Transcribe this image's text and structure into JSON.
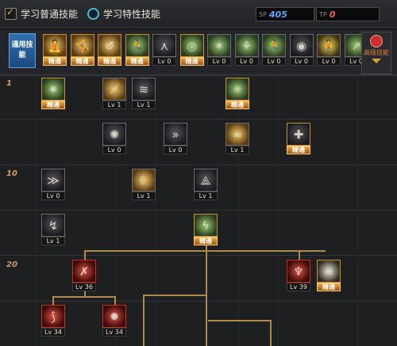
{
  "options": {
    "normal_skills": "学习普通技能",
    "special_skills": "学习特性技能"
  },
  "points": [
    {
      "label": "SP",
      "value": "405",
      "color": "#4aa8ff"
    },
    {
      "label": "TP",
      "value": "0",
      "color": "#ff5a3a"
    }
  ],
  "general_label": "通用技能",
  "advanced_label": "高级技能",
  "level_labels": [
    "1",
    "10",
    "20"
  ],
  "general_skills": [
    {
      "icon": "stance-icon",
      "glyph": "🧘",
      "badge": "精通",
      "mastered": true,
      "tone": "gold"
    },
    {
      "icon": "pose-icon",
      "glyph": "🤸",
      "badge": "精通",
      "mastered": true,
      "tone": "gold"
    },
    {
      "icon": "swing-icon",
      "glyph": "↺",
      "badge": "精通",
      "mastered": true,
      "tone": "gold"
    },
    {
      "icon": "runner-icon",
      "glyph": "🏃",
      "badge": "精通",
      "mastered": true,
      "tone": "green"
    },
    {
      "icon": "wings-icon",
      "glyph": "⋏",
      "badge": "Lv 0",
      "mastered": false,
      "tone": ""
    },
    {
      "icon": "target-icon",
      "glyph": "◎",
      "badge": "精通",
      "mastered": true,
      "tone": "green"
    },
    {
      "icon": "spin-icon",
      "glyph": "✶",
      "badge": "Lv 0",
      "mastered": false,
      "tone": "green"
    },
    {
      "icon": "leaf-icon",
      "glyph": "⚘",
      "badge": "Lv 0",
      "mastered": false,
      "tone": "green"
    },
    {
      "icon": "sprint-icon",
      "glyph": "🏃",
      "badge": "Lv 0",
      "mastered": false,
      "tone": "green"
    },
    {
      "icon": "shield-ring-icon",
      "glyph": "◉",
      "badge": "Lv 0",
      "mastered": false,
      "tone": ""
    },
    {
      "icon": "fighter-icon",
      "glyph": "🧍",
      "badge": "Lv 0",
      "mastered": false,
      "tone": "yellow"
    },
    {
      "icon": "dash-icon",
      "glyph": "↗",
      "badge": "Lv 0",
      "mastered": false,
      "tone": "green"
    }
  ],
  "tree_skills": [
    {
      "name": "whirl-kick-icon",
      "glyph": "✷",
      "badge": "精通",
      "mastered": true,
      "tone": "green"
    },
    {
      "name": "upper-slash-icon",
      "glyph": "⟋",
      "badge": "Lv 1",
      "mastered": false,
      "tone": "gold"
    },
    {
      "name": "triple-slash-icon",
      "glyph": "≋",
      "badge": "Lv 1",
      "mastered": false,
      "tone": ""
    },
    {
      "name": "back-step-icon",
      "glyph": "✳",
      "badge": "精通",
      "mastered": true,
      "tone": "green"
    },
    {
      "name": "burst-icon",
      "glyph": "✺",
      "badge": "Lv 0",
      "mastered": false,
      "tone": ""
    },
    {
      "name": "rush-icon",
      "glyph": "»",
      "badge": "Lv 0",
      "mastered": false,
      "tone": ""
    },
    {
      "name": "slash-wave-icon",
      "glyph": "≈",
      "badge": "Lv 1",
      "mastered": false,
      "tone": "gold"
    },
    {
      "name": "guard-icon",
      "glyph": "✚",
      "badge": "精通",
      "mastered": true,
      "tone": ""
    },
    {
      "name": "cross-cut-icon",
      "glyph": "≫",
      "badge": "Lv 0",
      "mastered": false,
      "tone": ""
    },
    {
      "name": "moon-slash-icon",
      "glyph": "☾",
      "badge": "Lv 1",
      "mastered": false,
      "tone": "gold"
    },
    {
      "name": "ghost-step-icon",
      "glyph": "⟁",
      "badge": "Lv 1",
      "mastered": false,
      "tone": ""
    },
    {
      "name": "wind-cut-icon",
      "glyph": "↯",
      "badge": "Lv 1",
      "mastered": false,
      "tone": ""
    },
    {
      "name": "lightning-icon",
      "glyph": "ϟ",
      "badge": "精通",
      "mastered": true,
      "tone": "green"
    },
    {
      "name": "blood-slash-icon",
      "glyph": "✗",
      "badge": "Lv 36",
      "mastered": false,
      "tone": "red"
    },
    {
      "name": "demon-icon",
      "glyph": "♆",
      "badge": "Lv 39",
      "mastered": false,
      "tone": "red"
    },
    {
      "name": "skull-icon",
      "glyph": "☠",
      "badge": "精通",
      "mastered": true,
      "tone": "white"
    },
    {
      "name": "flame-slash-icon",
      "glyph": "⟆",
      "badge": "Lv 34",
      "mastered": false,
      "tone": "red"
    },
    {
      "name": "fire-fan-icon",
      "glyph": "✹",
      "badge": "Lv 34",
      "mastered": false,
      "tone": "red"
    }
  ]
}
